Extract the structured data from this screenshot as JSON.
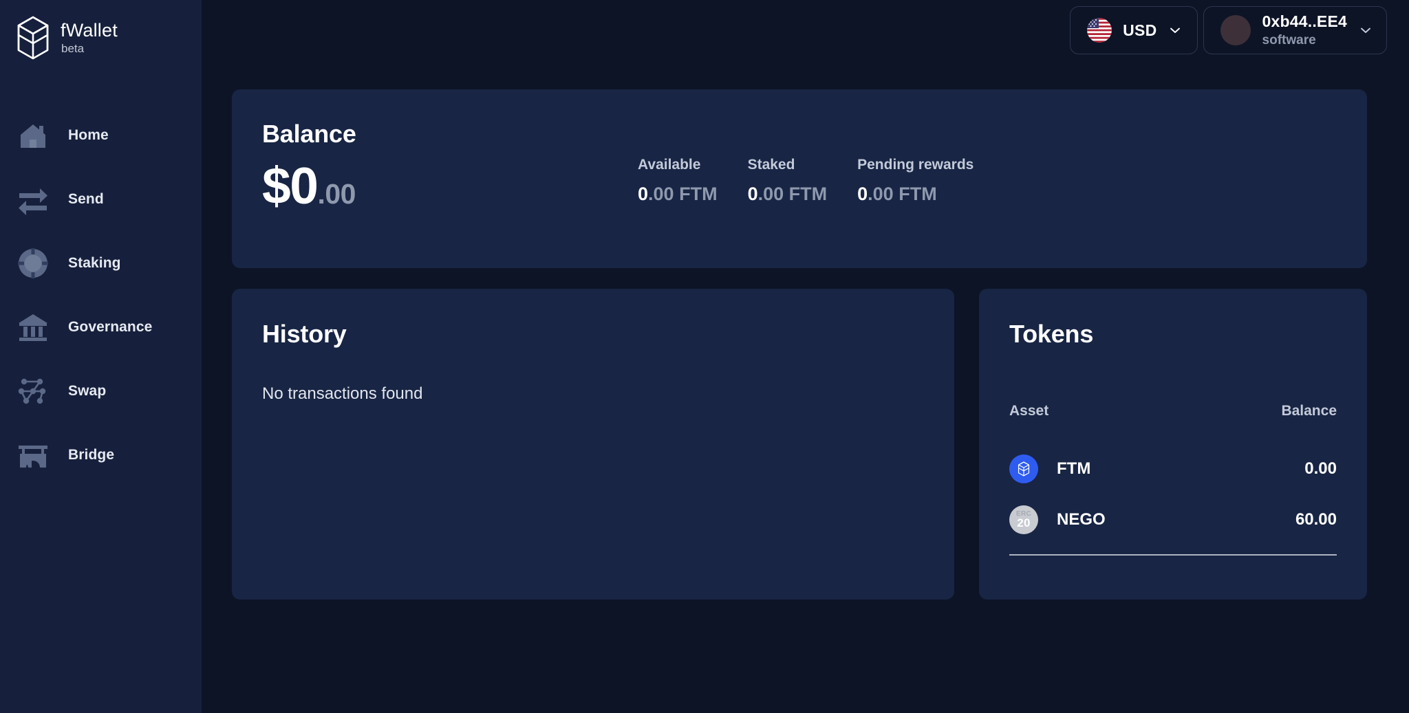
{
  "brand": {
    "name": "fWallet",
    "tag": "beta",
    "logo_icon": "fantom-cube-logo"
  },
  "sidebar": {
    "items": [
      {
        "label": "Home",
        "icon": "home-icon"
      },
      {
        "label": "Send",
        "icon": "send-arrows-icon"
      },
      {
        "label": "Staking",
        "icon": "staking-chip-icon"
      },
      {
        "label": "Governance",
        "icon": "governance-bank-icon"
      },
      {
        "label": "Swap",
        "icon": "swap-nodes-icon"
      },
      {
        "label": "Bridge",
        "icon": "bridge-icon"
      }
    ]
  },
  "topbar": {
    "currency": {
      "value": "USD",
      "flag_icon": "us-flag-icon",
      "chevron_icon": "chevron-down-icon"
    },
    "account": {
      "address": "0xb44..EE4",
      "type": "software",
      "avatar_icon": "avatar-icon",
      "chevron_icon": "chevron-down-icon"
    }
  },
  "balance": {
    "title": "Balance",
    "symbol": "$",
    "whole": "0",
    "cents": ".00",
    "stats": [
      {
        "label": "Available",
        "value": "0",
        "decimals": ".00",
        "unit": " FTM"
      },
      {
        "label": "Staked",
        "value": "0",
        "decimals": ".00",
        "unit": " FTM"
      },
      {
        "label": "Pending rewards",
        "value": "0",
        "decimals": ".00",
        "unit": " FTM"
      }
    ]
  },
  "history": {
    "title": "History",
    "empty_text": "No transactions found"
  },
  "tokens": {
    "title": "Tokens",
    "columns": {
      "asset": "Asset",
      "balance": "Balance"
    },
    "rows": [
      {
        "symbol": "FTM",
        "balance": "0.00",
        "icon": "fantom-token-icon"
      },
      {
        "symbol": "NEGO",
        "balance": "60.00",
        "icon": "erc20-token-icon",
        "badge_top": "ERC",
        "badge_bottom": "20"
      }
    ]
  },
  "colors": {
    "page_bg": "#0d1426",
    "sidebar_bg": "#16203c",
    "card_bg": "#182544",
    "text_primary": "#ffffff",
    "text_muted": "#8f99ae",
    "ftm_blue": "#2f5cf0",
    "erc_gray": "#c8cbd0",
    "border": "#2c3650"
  }
}
